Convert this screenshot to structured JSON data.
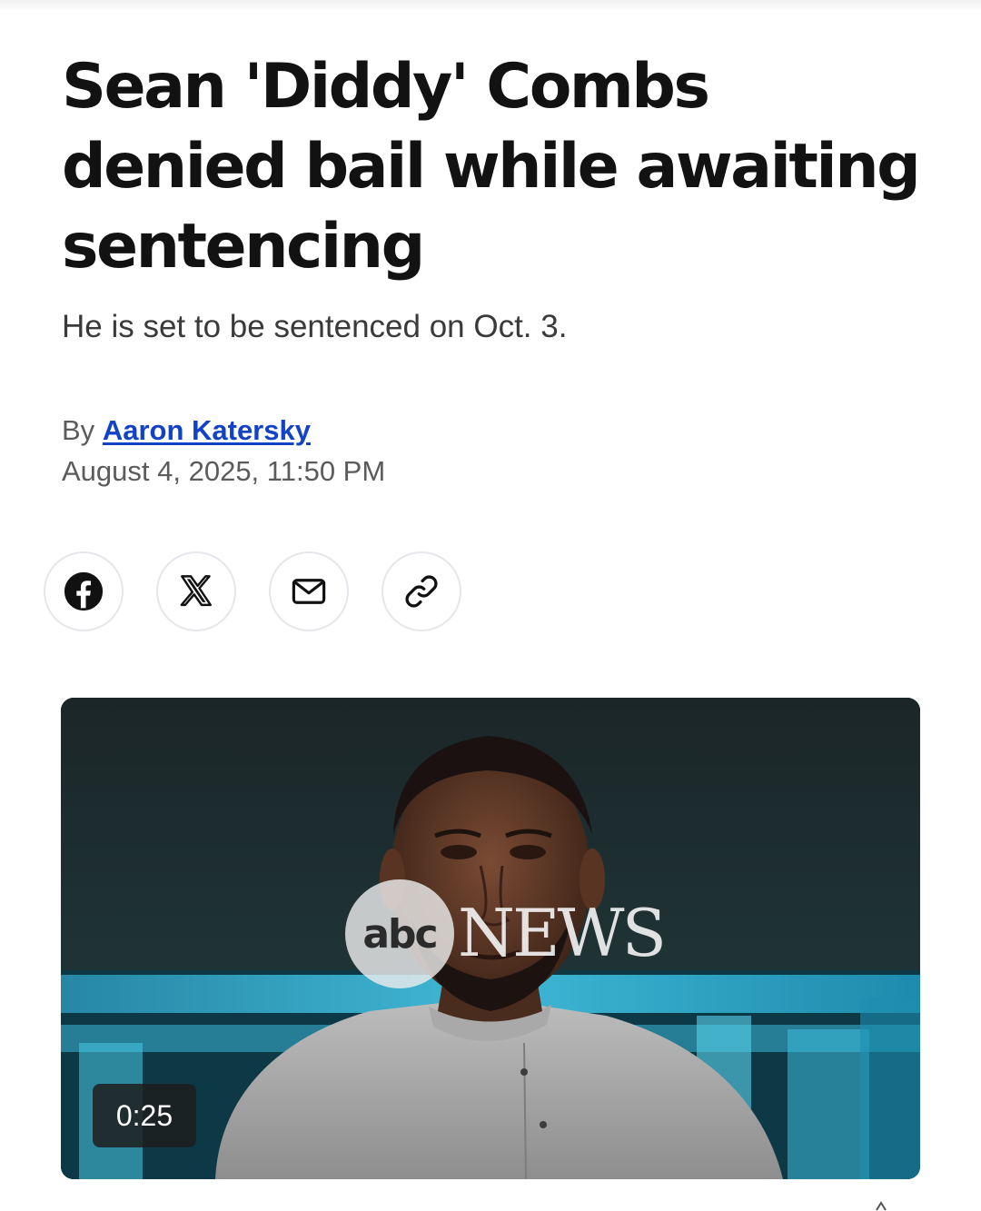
{
  "article": {
    "headline": "Sean 'Diddy' Combs denied bail while awaiting sentencing",
    "subheadline": "He is set to be sentenced on Oct. 3.",
    "byline_prefix": "By",
    "author": "Aaron Katersky",
    "date": "August 4, 2025, 11:50 PM"
  },
  "share": {
    "buttons": [
      {
        "icon": "facebook-icon"
      },
      {
        "icon": "x-icon"
      },
      {
        "icon": "mail-icon"
      },
      {
        "icon": "link-icon"
      }
    ]
  },
  "video": {
    "logo_abc": "abc",
    "logo_news": "NEWS",
    "duration": "0:25"
  },
  "colors": {
    "link": "#1142c8",
    "headline": "#121212",
    "meta": "#5b5b5b"
  }
}
